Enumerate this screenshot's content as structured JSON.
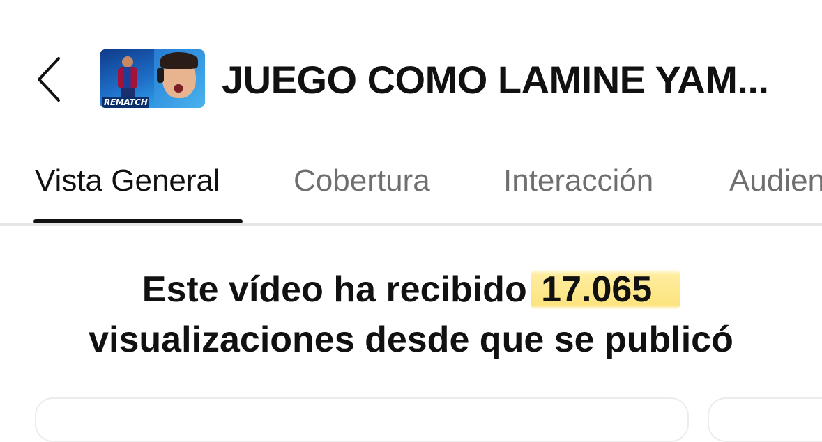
{
  "header": {
    "back_icon": "chevron-left-icon",
    "thumbnail": {
      "label": "REMATCH"
    },
    "title": "JUEGO COMO LAMINE YAM..."
  },
  "tabs": [
    {
      "label": "Vista General",
      "active": true
    },
    {
      "label": "Cobertura",
      "active": false
    },
    {
      "label": "Interacción",
      "active": false
    },
    {
      "label": "Audien",
      "active": false
    }
  ],
  "summary": {
    "prefix": "Este vídeo ha recibido",
    "views": "17.065",
    "suffix": "visualizaciones desde que se publicó"
  },
  "colors": {
    "highlight": "#fce278",
    "active_tab": "#111111",
    "inactive_tab": "#6f6f6f",
    "divider": "#e6e6e6"
  }
}
